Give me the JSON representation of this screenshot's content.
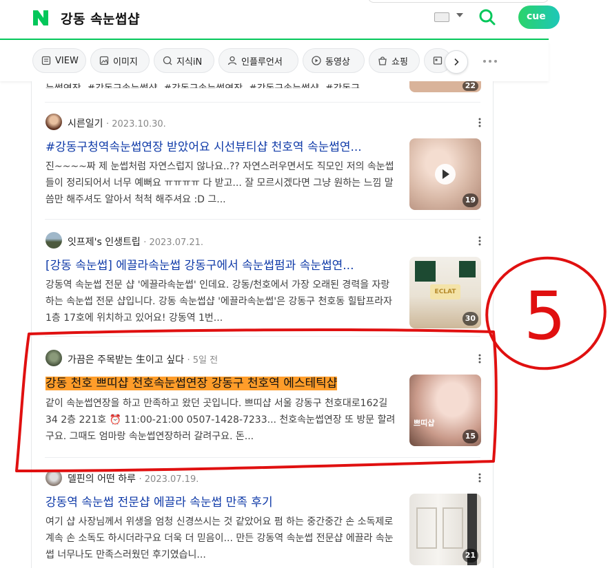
{
  "header": {
    "query": "강동 속눈썹샵",
    "cue_label": "cue"
  },
  "tabs": [
    {
      "label": "VIEW",
      "icon": "view-icon"
    },
    {
      "label": "이미지",
      "icon": "image-icon"
    },
    {
      "label": "지식iN",
      "icon": "knowledge-icon"
    },
    {
      "label": "인플루언서",
      "icon": "influencer-icon"
    },
    {
      "label": "동영상",
      "icon": "video-icon"
    },
    {
      "label": "쇼핑",
      "icon": "shopping-icon"
    }
  ],
  "top_snippet": "눈썹연장, #강동구속눈썹샵, #강동구속눈썹연장, #강동구속눈썹샵, #강동구",
  "top_thumb_count": "22",
  "results": [
    {
      "author": "시른일기",
      "date": "2023.10.30.",
      "title": "#강동구청역속눈썹연장 받았어요 시선뷰티샵 천호역 속눈썹연...",
      "desc": "진~~~~짜 제 눈썹처럼 자연스럽지 않나요..?? 자연스러우면서도 직모인 저의 속눈썹들이 정리되어서 너무 예뻐요 ㅠㅠㅠㅠ 다 받고... 잘 모르시겠다면 그냥 원하는 느낌 말씀만 해주셔도 알아서 척척 해주셔요 :D 그...",
      "count": "19"
    },
    {
      "author": "잇프제's 인생트립",
      "date": "2023.07.21.",
      "title": "[강동 속눈썹] 에끌라속눈썹 강동구에서 속눈썹펌과 속눈썹연...",
      "desc": "강동역 속눈썹 전문 샵 '에끌라속눈썹' 인데요. 강동/천호에서 가장 오래된 경력을 자랑하는 속눈썹 전문 샵입니다. 강동 속눈썹샵 '에끌라속눈썹'은 강동구 천호동 힐탑프라자 1층 17호에 위치하고 있어요! 강동역 1번...",
      "count": "30",
      "thumb_text": "ECLAT"
    },
    {
      "author": "가끔은 주목받는 生이고 싶다",
      "date": "5일 전",
      "title": "강동 천호 쁘띠샵 천호속눈썹연장 강동구 천호역 에스테틱샵",
      "desc": "같이 속눈썹연장을 하고 만족하고 왔던 곳입니다. 쁘띠샵 서울 강동구 천호대로162길 34 2층 221호 ⏰ 11:00-21:00 0507-1428-7233... 천호속눈썹연장 또 방문 할려구요. 그때도 엄마랑 속눈썹연장하러 갈려구요. 돈...",
      "count": "15",
      "thumb_text": "쁘띠샵"
    },
    {
      "author": "델핀의 어떤 하루",
      "date": "2023.07.19.",
      "title": "강동역 속눈썹 전문샵 에끌라 속눈썹 만족 후기",
      "desc": "여기 샵 사장님께서 위생을 엄청 신경쓰시는 것 같았어요 펌 하는 중간중간 손 소독제로 계속 손 소독도 하시더라구요 더욱 더 믿음이... 만든 강동역 속눈썹 전문샵 에끌라 속눈썹 너무나도 만족스러웠던 후기였습니...",
      "count": "21"
    }
  ],
  "annotation": {
    "label": "5",
    "color": "#e01010"
  },
  "colors": {
    "brand_green": "#03c75a",
    "link_blue": "#0f3aa8",
    "highlight": "#ff9d2a"
  }
}
